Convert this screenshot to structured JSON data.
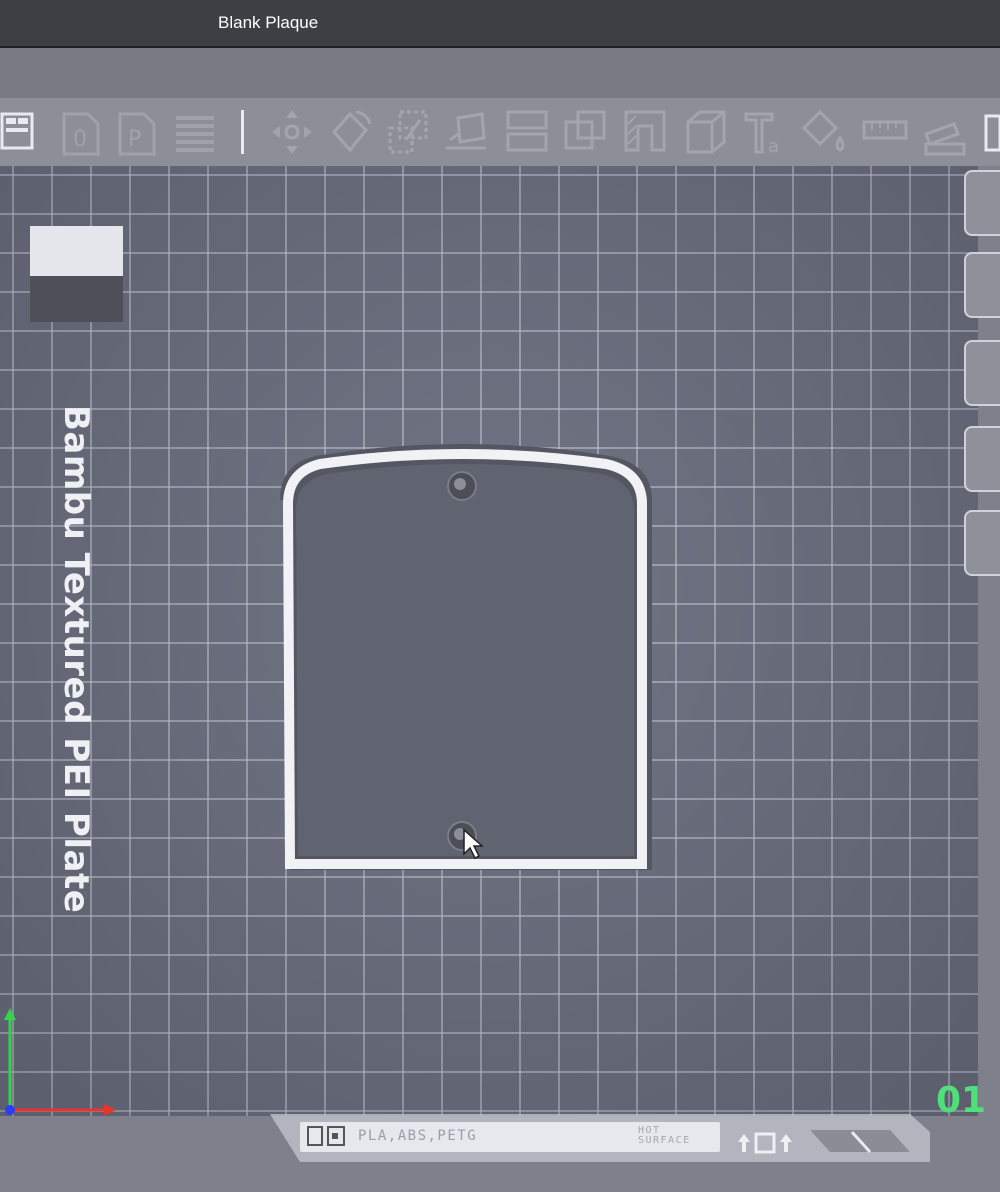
{
  "window": {
    "title": "Blank Plaque"
  },
  "toolbar": {
    "icons": [
      "layout-icon",
      "add-object-icon",
      "add-plate-icon",
      "list-icon",
      "move-icon",
      "rotate-icon",
      "scale-icon",
      "lay-on-face-icon",
      "cut-icon",
      "boolean-icon",
      "support-paint-icon",
      "seam-paint-icon",
      "cube-icon",
      "text-icon",
      "color-paint-icon",
      "measure-icon",
      "assembly-icon"
    ]
  },
  "plate": {
    "name": "Bambu Textured PEI Plate",
    "number": "01",
    "filament_types": "PLA,ABS,PETG",
    "warning": "HOT SURFACE",
    "colors": {
      "grid_bg": "#6c7080",
      "grid_line": "#d2d6e1",
      "plate_number": "#4fe07a"
    }
  },
  "model": {
    "name": "Blank Plaque",
    "mount_holes": 2
  },
  "axes": {
    "x_color": "#e8342a",
    "y_color": "#37d24a",
    "origin_color": "#2a3cff"
  }
}
